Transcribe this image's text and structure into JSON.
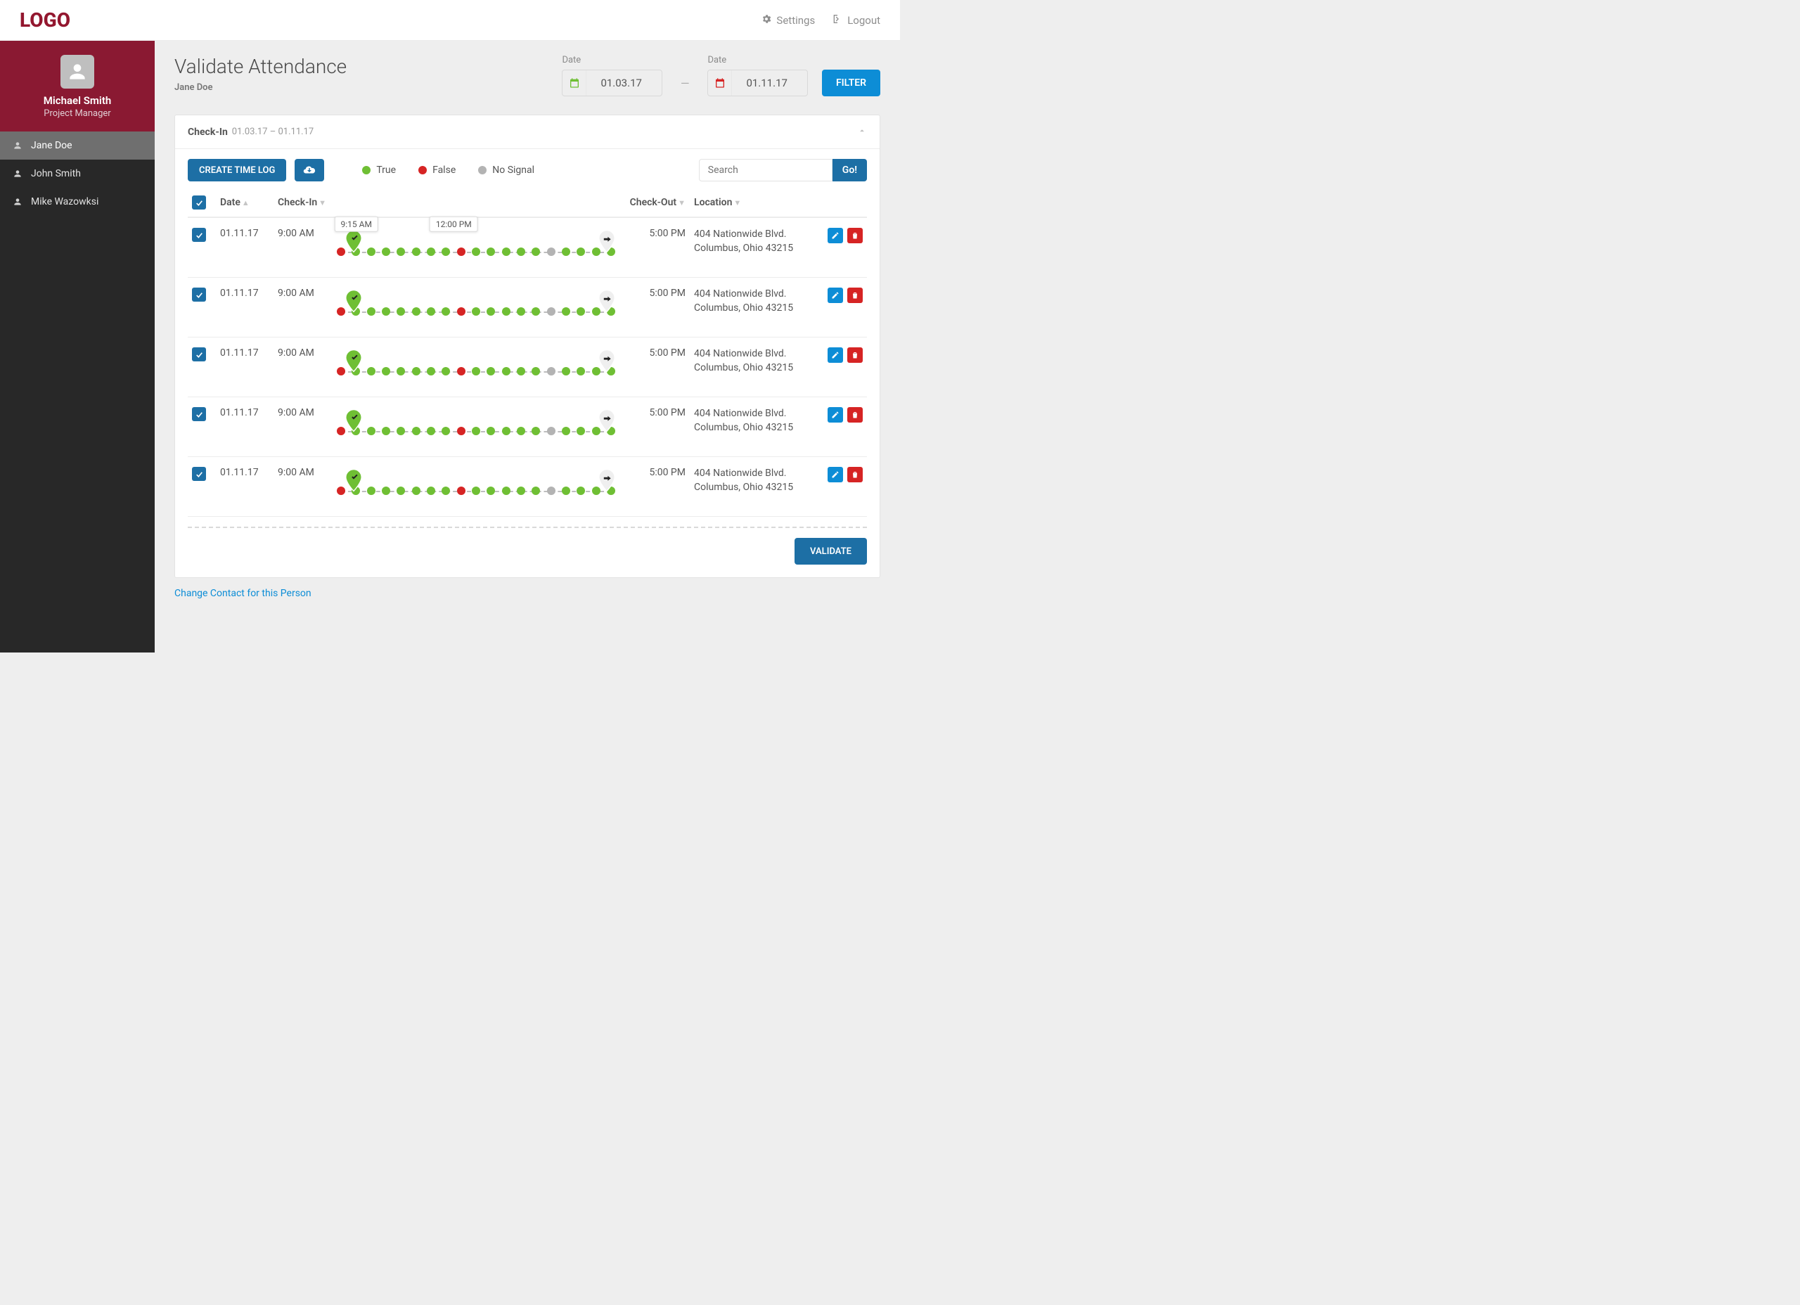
{
  "logo": "LOGO",
  "top_nav": {
    "settings": "Settings",
    "logout": "Logout"
  },
  "profile": {
    "name": "Michael Smith",
    "role": "Project Manager"
  },
  "sidebar": {
    "items": [
      {
        "label": "Jane Doe",
        "active": true
      },
      {
        "label": "John Smith",
        "active": false
      },
      {
        "label": "Mike Wazowksi",
        "active": false
      }
    ]
  },
  "page": {
    "title": "Validate Attendance",
    "subtitle": "Jane Doe"
  },
  "filters": {
    "date_label": "Date",
    "date_from": "01.03.17",
    "date_to": "01.11.17",
    "filter_btn": "FILTER",
    "separator": "—"
  },
  "panel": {
    "heading": "Check-In",
    "range": "01.03.17 – 01.11.17",
    "create_btn": "CREATE TIME LOG",
    "legend": {
      "true": "True",
      "false": "False",
      "nosignal": "No Signal"
    },
    "search_placeholder": "Search",
    "go_btn": "Go!",
    "columns": {
      "date": "Date",
      "checkin": "Check-In",
      "checkout": "Check-Out",
      "location": "Location"
    },
    "validate_btn": "VALIDATE"
  },
  "rows": [
    {
      "date": "01.11.17",
      "checkin": "9:00 AM",
      "checkout": "5:00 PM",
      "loc1": "404 Nationwide Blvd.",
      "loc2": "Columbus, Ohio 43215",
      "tooltips": [
        {
          "text": "9:15 AM",
          "pos": 7
        },
        {
          "text": "12:00 PM",
          "pos": 42
        }
      ],
      "points": [
        "r",
        "g",
        "g",
        "g",
        "g",
        "g",
        "g",
        "g",
        "r",
        "g",
        "g",
        "g",
        "g",
        "g",
        "x",
        "g",
        "g",
        "g",
        "g"
      ]
    },
    {
      "date": "01.11.17",
      "checkin": "9:00 AM",
      "checkout": "5:00 PM",
      "loc1": "404 Nationwide Blvd.",
      "loc2": "Columbus, Ohio 43215",
      "tooltips": [],
      "points": [
        "r",
        "g",
        "g",
        "g",
        "g",
        "g",
        "g",
        "g",
        "r",
        "g",
        "g",
        "g",
        "g",
        "g",
        "x",
        "g",
        "g",
        "g",
        "g"
      ]
    },
    {
      "date": "01.11.17",
      "checkin": "9:00 AM",
      "checkout": "5:00 PM",
      "loc1": "404 Nationwide Blvd.",
      "loc2": "Columbus, Ohio 43215",
      "tooltips": [],
      "points": [
        "r",
        "g",
        "g",
        "g",
        "g",
        "g",
        "g",
        "g",
        "r",
        "g",
        "g",
        "g",
        "g",
        "g",
        "x",
        "g",
        "g",
        "g",
        "g"
      ]
    },
    {
      "date": "01.11.17",
      "checkin": "9:00 AM",
      "checkout": "5:00 PM",
      "loc1": "404 Nationwide Blvd.",
      "loc2": "Columbus, Ohio 43215",
      "tooltips": [],
      "points": [
        "r",
        "g",
        "g",
        "g",
        "g",
        "g",
        "g",
        "g",
        "r",
        "g",
        "g",
        "g",
        "g",
        "g",
        "x",
        "g",
        "g",
        "g",
        "g"
      ]
    },
    {
      "date": "01.11.17",
      "checkin": "9:00 AM",
      "checkout": "5:00 PM",
      "loc1": "404 Nationwide Blvd.",
      "loc2": "Columbus, Ohio 43215",
      "tooltips": [],
      "points": [
        "r",
        "g",
        "g",
        "g",
        "g",
        "g",
        "g",
        "g",
        "r",
        "g",
        "g",
        "g",
        "g",
        "g",
        "x",
        "g",
        "g",
        "g",
        "g"
      ]
    }
  ],
  "footer_link": "Change Contact for this Person",
  "colors": {
    "green": "#6fbf34",
    "red": "#d62424",
    "grey": "#b3b3b3"
  }
}
